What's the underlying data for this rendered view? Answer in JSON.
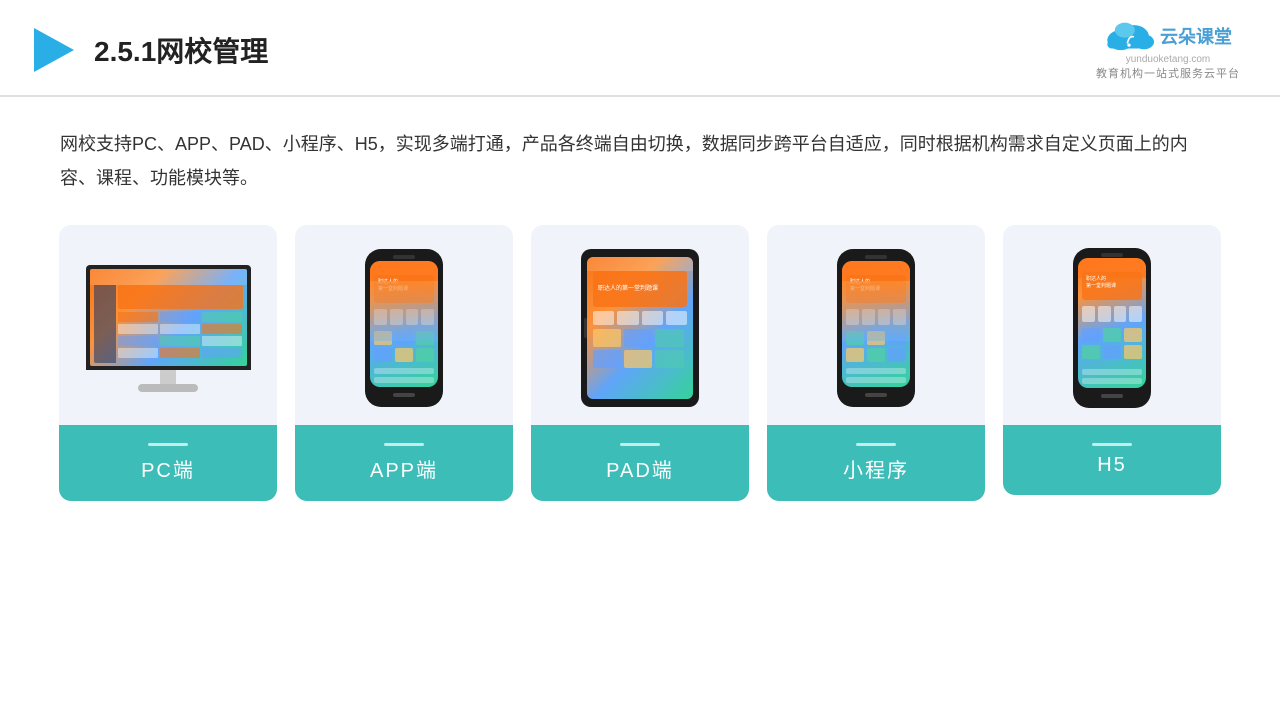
{
  "header": {
    "section_number": "2.5.1",
    "title": "网校管理",
    "logo_brand": "云朵课堂",
    "logo_domain": "yunduoketang.com",
    "logo_tagline": "教育机构一站式服务云平台"
  },
  "description": "网校支持PC、APP、PAD、小程序、H5，实现多端打通，产品各终端自由切换，数据同步跨平台自适应，同时根据机构需求自定义页面上的内容、课程、功能模块等。",
  "cards": [
    {
      "id": "pc",
      "label": "PC端"
    },
    {
      "id": "app",
      "label": "APP端"
    },
    {
      "id": "pad",
      "label": "PAD端"
    },
    {
      "id": "miniprogram",
      "label": "小程序"
    },
    {
      "id": "h5",
      "label": "H5"
    }
  ]
}
